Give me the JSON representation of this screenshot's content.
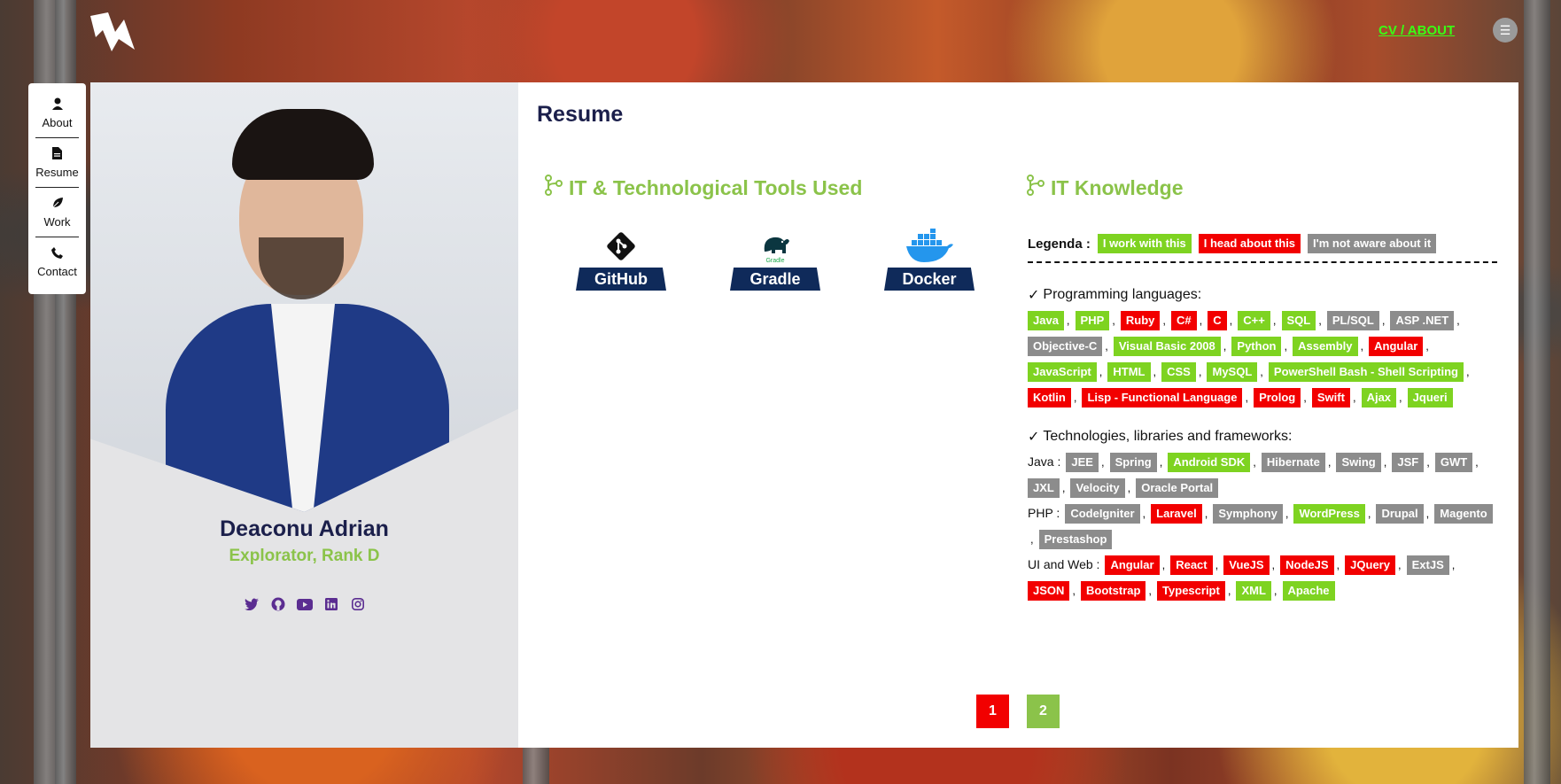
{
  "header": {
    "logo_label": "",
    "nav_link": "CV / ABOUT",
    "menu_icon": "☰"
  },
  "side_nav": [
    {
      "label": "About",
      "icon": "user-icon"
    },
    {
      "label": "Resume",
      "icon": "file-icon"
    },
    {
      "label": "Work",
      "icon": "leaf-icon"
    },
    {
      "label": "Contact",
      "icon": "phone-icon"
    }
  ],
  "profile": {
    "name": "Deaconu Adrian",
    "role": "Explorator, Rank D",
    "socials": [
      "twitter-icon",
      "github-icon",
      "youtube-icon",
      "linkedin-icon",
      "instagram-icon"
    ]
  },
  "resume": {
    "title": "Resume",
    "tools_title": "IT & Technological Tools Used",
    "tools": [
      {
        "label": "GitHub",
        "icon": "git-icon"
      },
      {
        "label": "Gradle",
        "icon": "gradle-icon"
      },
      {
        "label": "Docker",
        "icon": "docker-icon"
      }
    ],
    "knowledge_title": "IT Knowledge",
    "legend_label": "Legenda :",
    "legend": [
      {
        "text": "I work with this",
        "color": "green"
      },
      {
        "text": "I head about this",
        "color": "red"
      },
      {
        "text": "I'm not aware about it",
        "color": "gray"
      }
    ],
    "programming_title": "Programming languages:",
    "programming": [
      {
        "text": "Java",
        "color": "green"
      },
      {
        "text": "PHP",
        "color": "green"
      },
      {
        "text": "Ruby",
        "color": "red"
      },
      {
        "text": "C#",
        "color": "red"
      },
      {
        "text": "C",
        "color": "red"
      },
      {
        "text": "C++",
        "color": "green"
      },
      {
        "text": "SQL",
        "color": "green"
      },
      {
        "text": "PL/SQL",
        "color": "gray"
      },
      {
        "text": "ASP .NET",
        "color": "gray"
      },
      {
        "text": "Objective-C",
        "color": "gray"
      },
      {
        "text": "Visual Basic 2008",
        "color": "green"
      },
      {
        "text": "Python",
        "color": "green"
      },
      {
        "text": "Assembly",
        "color": "green"
      },
      {
        "text": "Angular",
        "color": "red"
      },
      {
        "text": "JavaScript",
        "color": "green"
      },
      {
        "text": "HTML",
        "color": "green"
      },
      {
        "text": "CSS",
        "color": "green"
      },
      {
        "text": "MySQL",
        "color": "green"
      },
      {
        "text": "PowerShell Bash - Shell Scripting",
        "color": "green"
      },
      {
        "text": "Kotlin",
        "color": "red"
      },
      {
        "text": "Lisp - Functional Language",
        "color": "red"
      },
      {
        "text": "Prolog",
        "color": "red"
      },
      {
        "text": "Swift",
        "color": "red"
      },
      {
        "text": "Ajax",
        "color": "green"
      },
      {
        "text": "Jqueri",
        "color": "green"
      }
    ],
    "frameworks_title": "Technologies, libraries and frameworks:",
    "frameworks": [
      {
        "label": "Java :",
        "items": [
          {
            "text": "JEE",
            "color": "gray"
          },
          {
            "text": "Spring",
            "color": "gray"
          },
          {
            "text": "Android SDK",
            "color": "green"
          },
          {
            "text": "Hibernate",
            "color": "gray"
          },
          {
            "text": "Swing",
            "color": "gray"
          },
          {
            "text": "JSF",
            "color": "gray"
          },
          {
            "text": "GWT",
            "color": "gray"
          },
          {
            "text": "JXL",
            "color": "gray"
          },
          {
            "text": "Velocity",
            "color": "gray"
          },
          {
            "text": "Oracle Portal",
            "color": "gray"
          }
        ]
      },
      {
        "label": "PHP :",
        "items": [
          {
            "text": "CodeIgniter",
            "color": "gray"
          },
          {
            "text": "Laravel",
            "color": "red"
          },
          {
            "text": "Symphony",
            "color": "gray"
          },
          {
            "text": "WordPress",
            "color": "green"
          },
          {
            "text": "Drupal",
            "color": "gray"
          },
          {
            "text": "Magento",
            "color": "gray"
          },
          {
            "text": "Prestashop",
            "color": "gray"
          }
        ]
      },
      {
        "label": "UI and Web :",
        "items": [
          {
            "text": "Angular",
            "color": "red"
          },
          {
            "text": "React",
            "color": "red"
          },
          {
            "text": "VueJS",
            "color": "red"
          },
          {
            "text": "NodeJS",
            "color": "red"
          },
          {
            "text": "JQuery",
            "color": "red"
          },
          {
            "text": "ExtJS",
            "color": "gray"
          },
          {
            "text": "JSON",
            "color": "red"
          },
          {
            "text": "Bootstrap",
            "color": "red"
          },
          {
            "text": "Typescript",
            "color": "red"
          },
          {
            "text": "XML",
            "color": "green"
          },
          {
            "text": "Apache",
            "color": "green"
          }
        ]
      }
    ],
    "pagination": [
      {
        "label": "1",
        "active": true
      },
      {
        "label": "2",
        "active": false
      }
    ]
  },
  "colors": {
    "green": "#7ed321",
    "red": "#f20000",
    "gray": "#8c8c8c",
    "accent_green": "#8bc34a",
    "navy": "#1b1f4b"
  }
}
